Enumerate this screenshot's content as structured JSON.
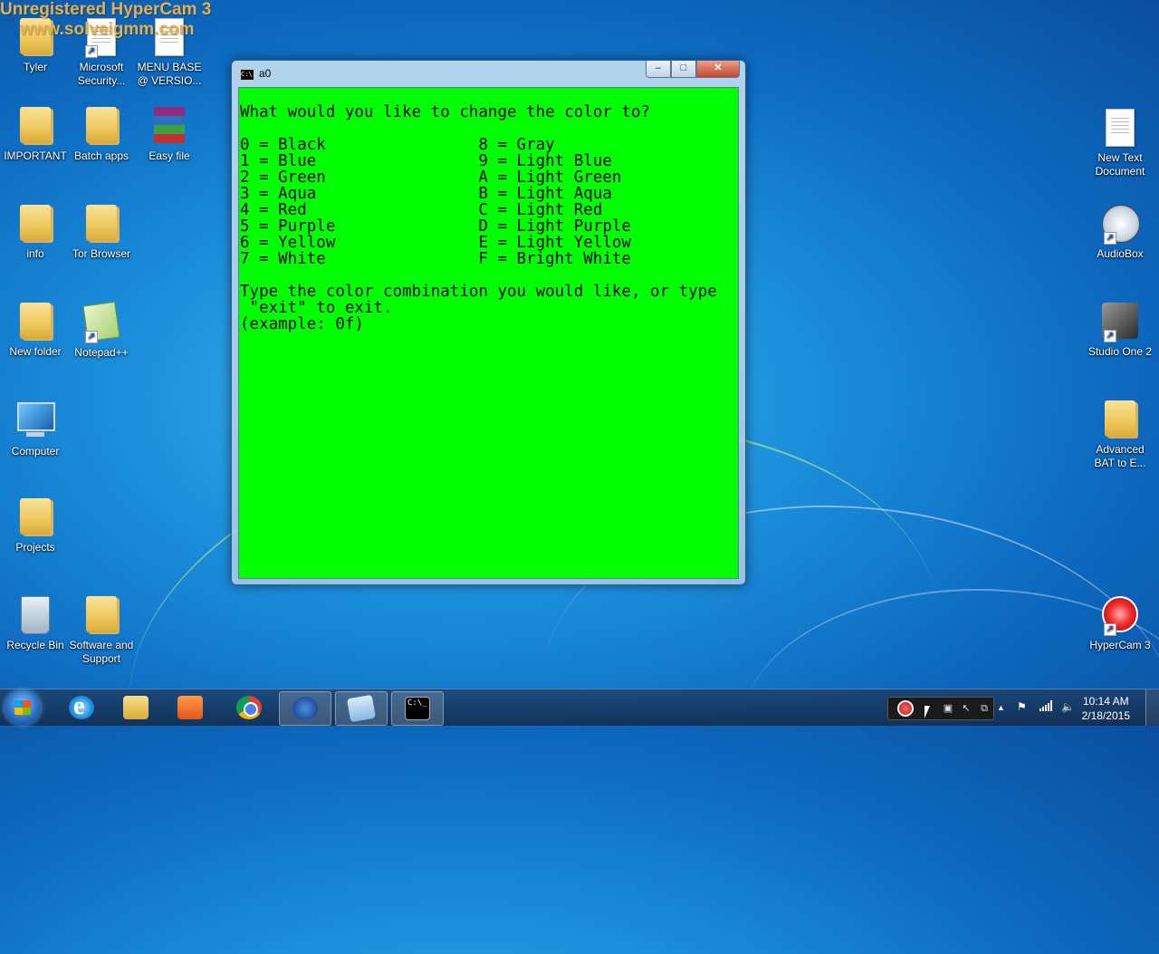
{
  "watermark": {
    "line1": "Unregistered HyperCam 3",
    "line2": "www.solveigmm.com"
  },
  "desktop_icons": {
    "tyler": "Tyler",
    "msecurity": "Microsoft Security...",
    "menubase": "MENU BASE @ VERSIO...",
    "important": "IMPORTANT",
    "batchapps": "Batch apps",
    "easyfile": "Easy file",
    "info": "info",
    "torbrowser": "Tor Browser",
    "newfolder": "New folder",
    "notepadpp": "Notepad++",
    "computer": "Computer",
    "projects": "Projects",
    "recyclebin": "Recycle Bin",
    "softwaresupport": "Software and Support",
    "newtextdoc": "New Text Document",
    "audiobox": "AudioBox",
    "studioone": "Studio One 2",
    "advancedbat": "Advanced BAT to E...",
    "hypercam": "HyperCam 3"
  },
  "console_window": {
    "title": "a0",
    "icon_text": "C:\\.",
    "buttons": {
      "minimize": "–",
      "maximize": "□",
      "close": "✕"
    },
    "background": "#00ff00",
    "lines": [
      "What would you like to change the color to?",
      "0 = Black                8 = Gray",
      "1 = Blue                 9 = Light Blue",
      "2 = Green                A = Light Green",
      "3 = Aqua                 B = Light Aqua",
      "4 = Red                  C = Light Red",
      "5 = Purple               D = Light Purple",
      "6 = Yellow               E = Light Yellow",
      "7 = White                F = Bright White",
      "Type the color combination you would like, or type",
      " \"exit\" to exit.",
      "(example: 0f)"
    ]
  },
  "taskbar": {
    "cmd_icon_text": "C:\\_",
    "tray_arrow": "▲",
    "clock_time": "10:14 AM",
    "clock_date": "2/18/2015"
  }
}
